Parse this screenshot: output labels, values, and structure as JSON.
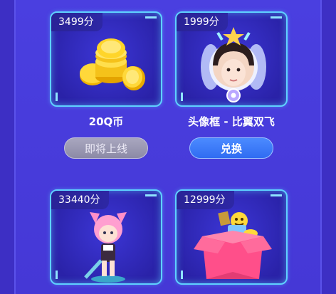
{
  "rewards": [
    {
      "price": "3499分",
      "title": "20Q币",
      "button": "即将上线",
      "icon": "coins-icon"
    },
    {
      "price": "1999分",
      "title": "头像框 - 比翼双飞",
      "button": "兑换",
      "icon": "avatar-frame-icon"
    },
    {
      "price": "33440分",
      "title": "",
      "button": "",
      "icon": "figurine-icon"
    },
    {
      "price": "12999分",
      "title": "",
      "button": "",
      "icon": "gift-box-icon"
    }
  ],
  "colors": {
    "accent": "#5fd1ff",
    "button_primary": "#2f6cf2",
    "button_disabled": "#8c8aa6"
  }
}
